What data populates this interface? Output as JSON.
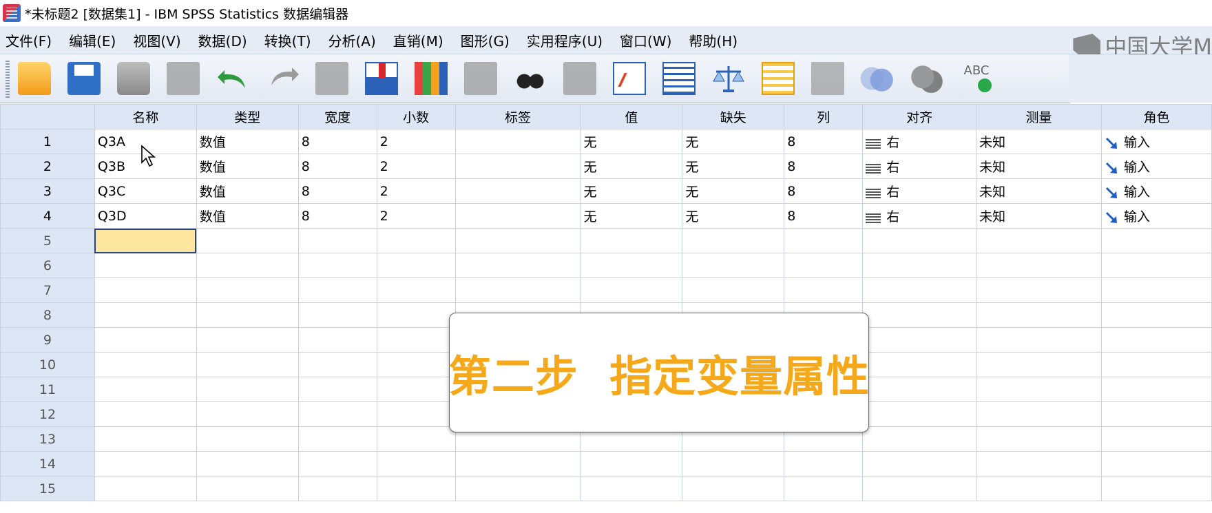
{
  "window": {
    "title": "*未标题2 [数据集1] - IBM SPSS Statistics 数据编辑器"
  },
  "menu": [
    "文件(F)",
    "编辑(E)",
    "视图(V)",
    "数据(D)",
    "转换(T)",
    "分析(A)",
    "直销(M)",
    "图形(G)",
    "实用程序(U)",
    "窗口(W)",
    "帮助(H)"
  ],
  "watermark": "中国大学M",
  "toolbar": {
    "icons": [
      "folder-open-icon",
      "save-icon",
      "print-icon",
      "dialog-recall-icon",
      "undo-icon",
      "redo-icon",
      "goto-case-icon",
      "insert-cases-icon",
      "insert-variable-icon",
      "split-file-icon",
      "find-icon",
      "weight-cases-icon",
      "chart-builder-icon",
      "value-labels-icon",
      "scale-icon",
      "data-table-icon",
      "sort-icon",
      "use-variable-sets-icon",
      "show-all-variables-icon",
      "spell-check-icon"
    ],
    "spell_label": "ABC"
  },
  "columns": [
    "名称",
    "类型",
    "宽度",
    "小数",
    "标签",
    "值",
    "缺失",
    "列",
    "对齐",
    "测量",
    "角色"
  ],
  "rows": [
    {
      "num": "1",
      "name": "Q3A",
      "type": "数值",
      "width": "8",
      "decimals": "2",
      "label": "",
      "values": "无",
      "missing": "无",
      "columns": "8",
      "align": "右",
      "measure": "未知",
      "role": "输入"
    },
    {
      "num": "2",
      "name": "Q3B",
      "type": "数值",
      "width": "8",
      "decimals": "2",
      "label": "",
      "values": "无",
      "missing": "无",
      "columns": "8",
      "align": "右",
      "measure": "未知",
      "role": "输入"
    },
    {
      "num": "3",
      "name": "Q3C",
      "type": "数值",
      "width": "8",
      "decimals": "2",
      "label": "",
      "values": "无",
      "missing": "无",
      "columns": "8",
      "align": "右",
      "measure": "未知",
      "role": "输入"
    },
    {
      "num": "4",
      "name": "Q3D",
      "type": "数值",
      "width": "8",
      "decimals": "2",
      "label": "",
      "values": "无",
      "missing": "无",
      "columns": "8",
      "align": "右",
      "measure": "未知",
      "role": "输入"
    }
  ],
  "empty_rows": [
    "5",
    "6",
    "7",
    "8",
    "9",
    "10",
    "11",
    "12",
    "13",
    "14",
    "15"
  ],
  "overlay": {
    "text": "第二步  指定变量属性"
  },
  "colors": {
    "overlay_text": "#f5a91a",
    "header_bg": "#dce6f4",
    "active_cell": "#fde6a0"
  }
}
